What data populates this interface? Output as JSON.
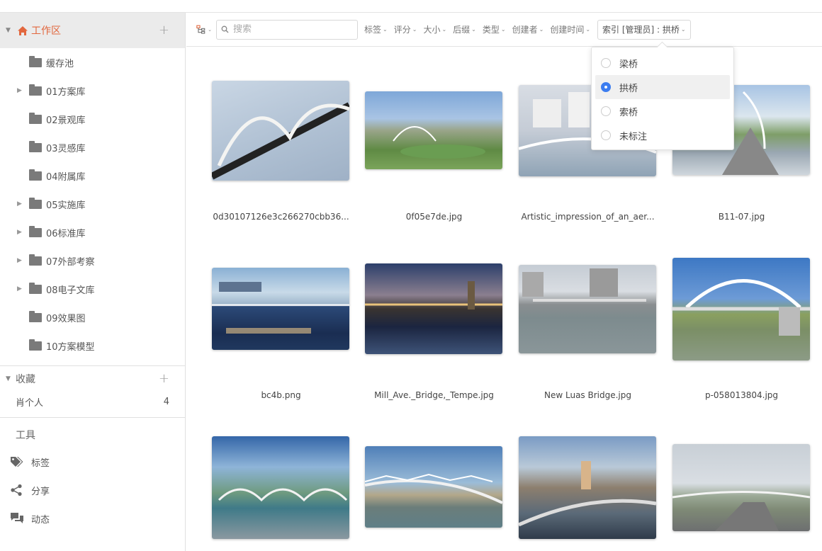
{
  "sidebar": {
    "workspace": {
      "label": "工作区",
      "icon": "home-icon"
    },
    "folders": [
      {
        "label": "缓存池",
        "expandable": false
      },
      {
        "label": "01方案库",
        "expandable": true
      },
      {
        "label": "02景观库",
        "expandable": false
      },
      {
        "label": "03灵感库",
        "expandable": false
      },
      {
        "label": "04附属库",
        "expandable": false
      },
      {
        "label": "05实施库",
        "expandable": true
      },
      {
        "label": "06标准库",
        "expandable": true
      },
      {
        "label": "07外部考察",
        "expandable": true
      },
      {
        "label": "08电子文库",
        "expandable": true
      },
      {
        "label": "09效果图",
        "expandable": false
      },
      {
        "label": "10方案模型",
        "expandable": false
      }
    ],
    "favorites": {
      "title": "收藏",
      "items": [
        {
          "label": "肖个人",
          "count": "4"
        }
      ]
    },
    "tools": {
      "title": "工具",
      "items": [
        {
          "label": "标签",
          "icon": "tag-icon"
        },
        {
          "label": "分享",
          "icon": "share-icon"
        },
        {
          "label": "动态",
          "icon": "activity-icon"
        }
      ]
    }
  },
  "toolbar": {
    "search_placeholder": "搜索",
    "filters": [
      "标签",
      "评分",
      "大小",
      "后缀",
      "类型",
      "创建者",
      "创建时间"
    ],
    "active_filter": "索引 [管理员] : 拱桥"
  },
  "dropdown": {
    "options": [
      {
        "label": "梁桥",
        "selected": false
      },
      {
        "label": "拱桥",
        "selected": true
      },
      {
        "label": "索桥",
        "selected": false
      },
      {
        "label": "未标注",
        "selected": false
      }
    ]
  },
  "files": [
    {
      "name": "0d30107126e3c266270cbb36..."
    },
    {
      "name": "0f05e7de.jpg"
    },
    {
      "name": "Artistic_impression_of_an_aer..."
    },
    {
      "name": "B11-07.jpg"
    },
    {
      "name": "bc4b.png"
    },
    {
      "name": "Mill_Ave._Bridge,_Tempe.jpg"
    },
    {
      "name": "New Luas Bridge.jpg"
    },
    {
      "name": "p-058013804.jpg"
    },
    {
      "name": ""
    },
    {
      "name": ""
    },
    {
      "name": ""
    },
    {
      "name": ""
    }
  ],
  "colors": {
    "accent": "#e2673e",
    "radio_selected": "#3c7df0"
  }
}
